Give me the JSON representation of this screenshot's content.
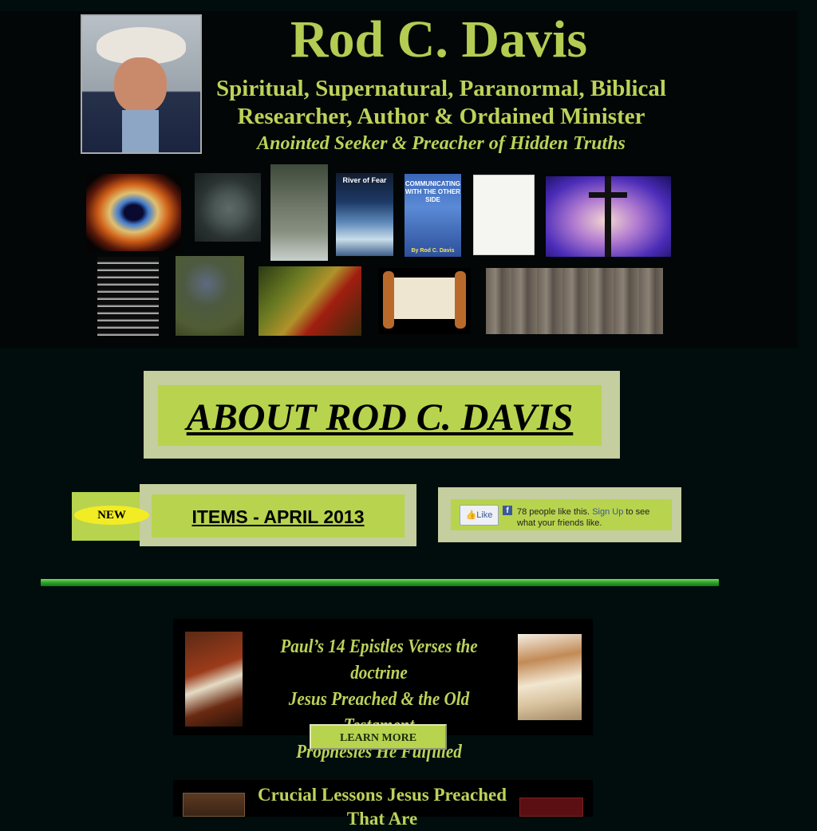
{
  "header": {
    "site_title": "Rod C. Davis",
    "subtitle_line1": "Spiritual, Supernatural, Paranormal, Biblical",
    "subtitle_line2": "Researcher, Author & Ordained Minister",
    "tagline": "Anointed Seeker & Preacher of Hidden Truths",
    "book1_title": "River of Fear",
    "book2_title": "COMMUNICATING WITH THE OTHER SIDE",
    "book2_author": "By Rod C. Davis"
  },
  "about": {
    "label": "ABOUT ROD C. DAVIS"
  },
  "new_items": {
    "badge": "NEW",
    "label": "ITEMS - APRIL 2013"
  },
  "facebook": {
    "like_button": "Like",
    "text_before": "78 people like this.",
    "sign_up": "Sign Up",
    "text_after": "to see what your friends like."
  },
  "promo1": {
    "line1": "Paul’s 14 Epistles Verses the doctrine",
    "line2": "Jesus Preached & the Old Testament",
    "line3": "Prophesies He Fulfilled",
    "button": "LEARN MORE"
  },
  "promo2": {
    "line1": "Crucial Lessons Jesus Preached",
    "line2": "That Are"
  },
  "colors": {
    "background": "#010d0c",
    "accent": "#b8d34e",
    "title": "#b3cc52",
    "frame": "#c4ce9e",
    "divider": "#2fa82a"
  }
}
